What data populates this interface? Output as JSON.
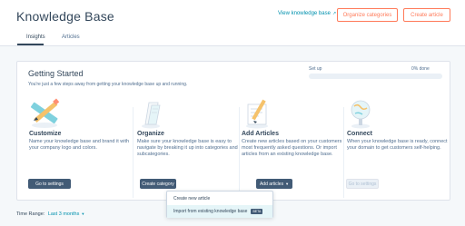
{
  "header": {
    "title": "Knowledge Base",
    "view_link": "View knowledge base",
    "organize_button": "Organize categories",
    "create_button": "Create article",
    "tabs": [
      {
        "label": "Insights",
        "active": true
      },
      {
        "label": "Articles",
        "active": false
      }
    ]
  },
  "getting_started": {
    "title": "Getting Started",
    "subtitle": "You're just a few steps away from getting your knowledge base up and running.",
    "progress_label": "Set up",
    "progress_value": "0% done",
    "progress_fraction": 0,
    "steps": [
      {
        "icon": "pencil-ruler-icon",
        "title": "Customize",
        "description": "Name your knowledge base and brand it with your company logo and colors.",
        "button": "Go to settings",
        "enabled": true
      },
      {
        "icon": "folder-sheets-icon",
        "title": "Organize",
        "description": "Make sure your knowledge base is easy to navigate by breaking it up into categories and subcategories.",
        "button": "Create category",
        "enabled": true
      },
      {
        "icon": "article-pencil-icon",
        "title": "Add Articles",
        "description": "Create new articles based on your customers most frequently asked questions. Or import articles from an existing knowledge base.",
        "button": "Add articles",
        "enabled": true
      },
      {
        "icon": "globe-lamp-icon",
        "title": "Connect",
        "description": "When your knowledge base is ready, connect your domain to get customers self-helping.",
        "button": "Go to settings",
        "enabled": false
      }
    ]
  },
  "dropdown": {
    "items": [
      {
        "label": "Create new article"
      },
      {
        "label": "Import from existing knowledge base",
        "badge": "BETA"
      }
    ]
  },
  "time_range": {
    "label": "Time Range:",
    "value": "Last 3 months"
  },
  "colors": {
    "accent": "#ff7a59",
    "link": "#0091ae",
    "dark_button": "#425b76",
    "text": "#33475b"
  }
}
